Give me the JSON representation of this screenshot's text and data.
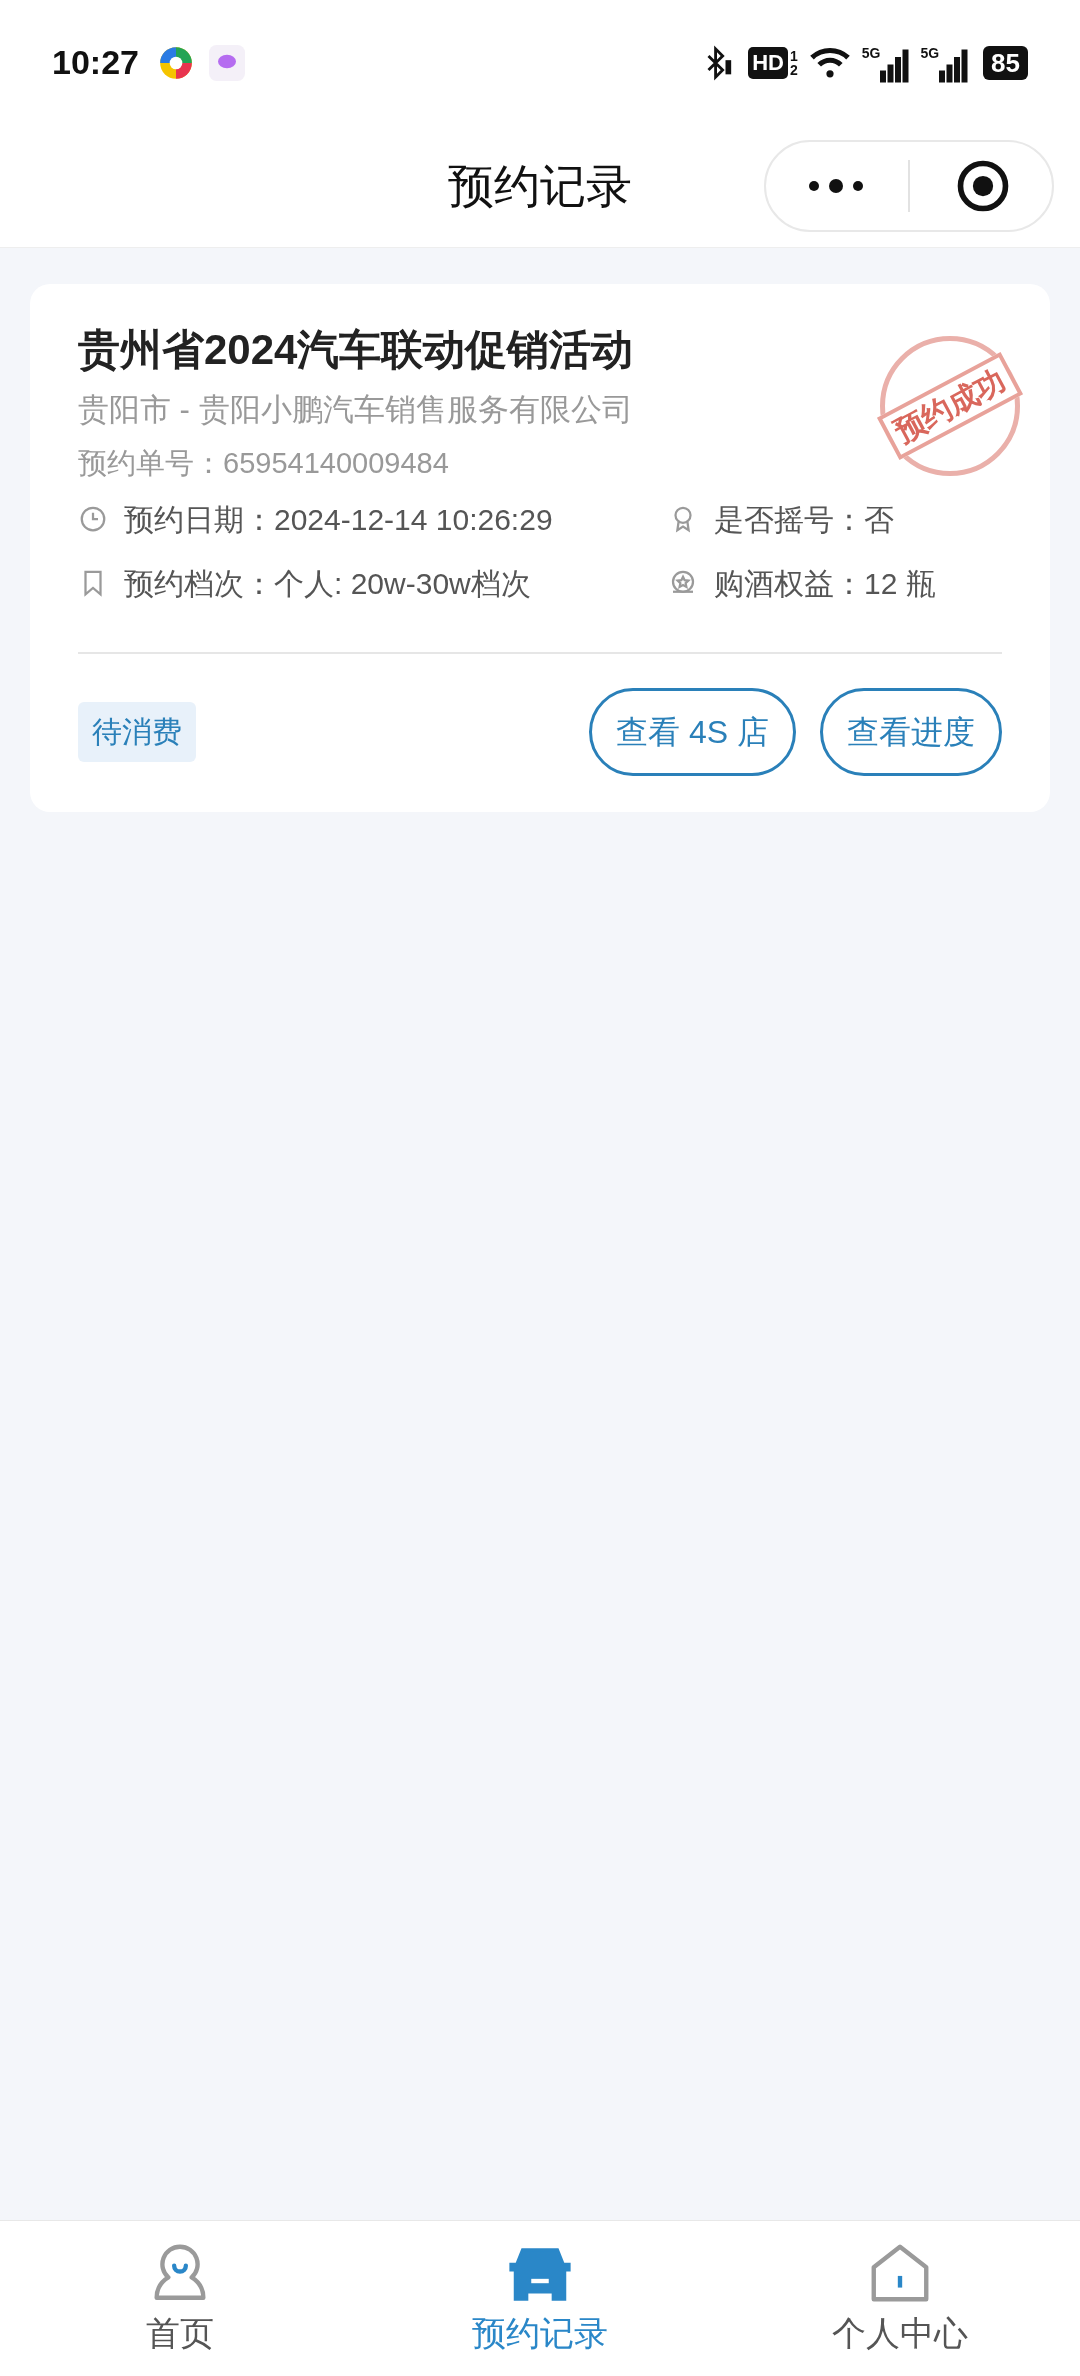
{
  "status_bar": {
    "time": "10:27",
    "hd": "HD",
    "sim_slots": [
      "1",
      "2"
    ],
    "signals": [
      {
        "label": "5G"
      },
      {
        "label": "5G"
      }
    ],
    "battery": "85"
  },
  "nav": {
    "title": "预约记录"
  },
  "records": [
    {
      "title": "贵州省2024汽车联动促销活动",
      "dealer": "贵阳市 - 贵阳小鹏汽车销售服务有限公司",
      "order_no": "预约单号：65954140009484",
      "stamp": "预约成功",
      "details": [
        {
          "kind": "clock",
          "text": "预约日期：2024-12-14 10:26:29"
        },
        {
          "kind": "medal",
          "text": "是否摇号：否"
        },
        {
          "kind": "bookmark",
          "text": "预约档次：个人: 20w-30w档次"
        },
        {
          "kind": "gift",
          "text": "购酒权益：12 瓶"
        }
      ],
      "status_tag": "待消费",
      "buttons": [
        "查看 4S 店",
        "查看进度"
      ]
    }
  ],
  "tab_bar": [
    {
      "kind": "home",
      "label": "首页",
      "selected": false
    },
    {
      "kind": "car",
      "label": "预约记录",
      "selected": true
    },
    {
      "kind": "house",
      "label": "个人中心",
      "selected": false
    }
  ]
}
